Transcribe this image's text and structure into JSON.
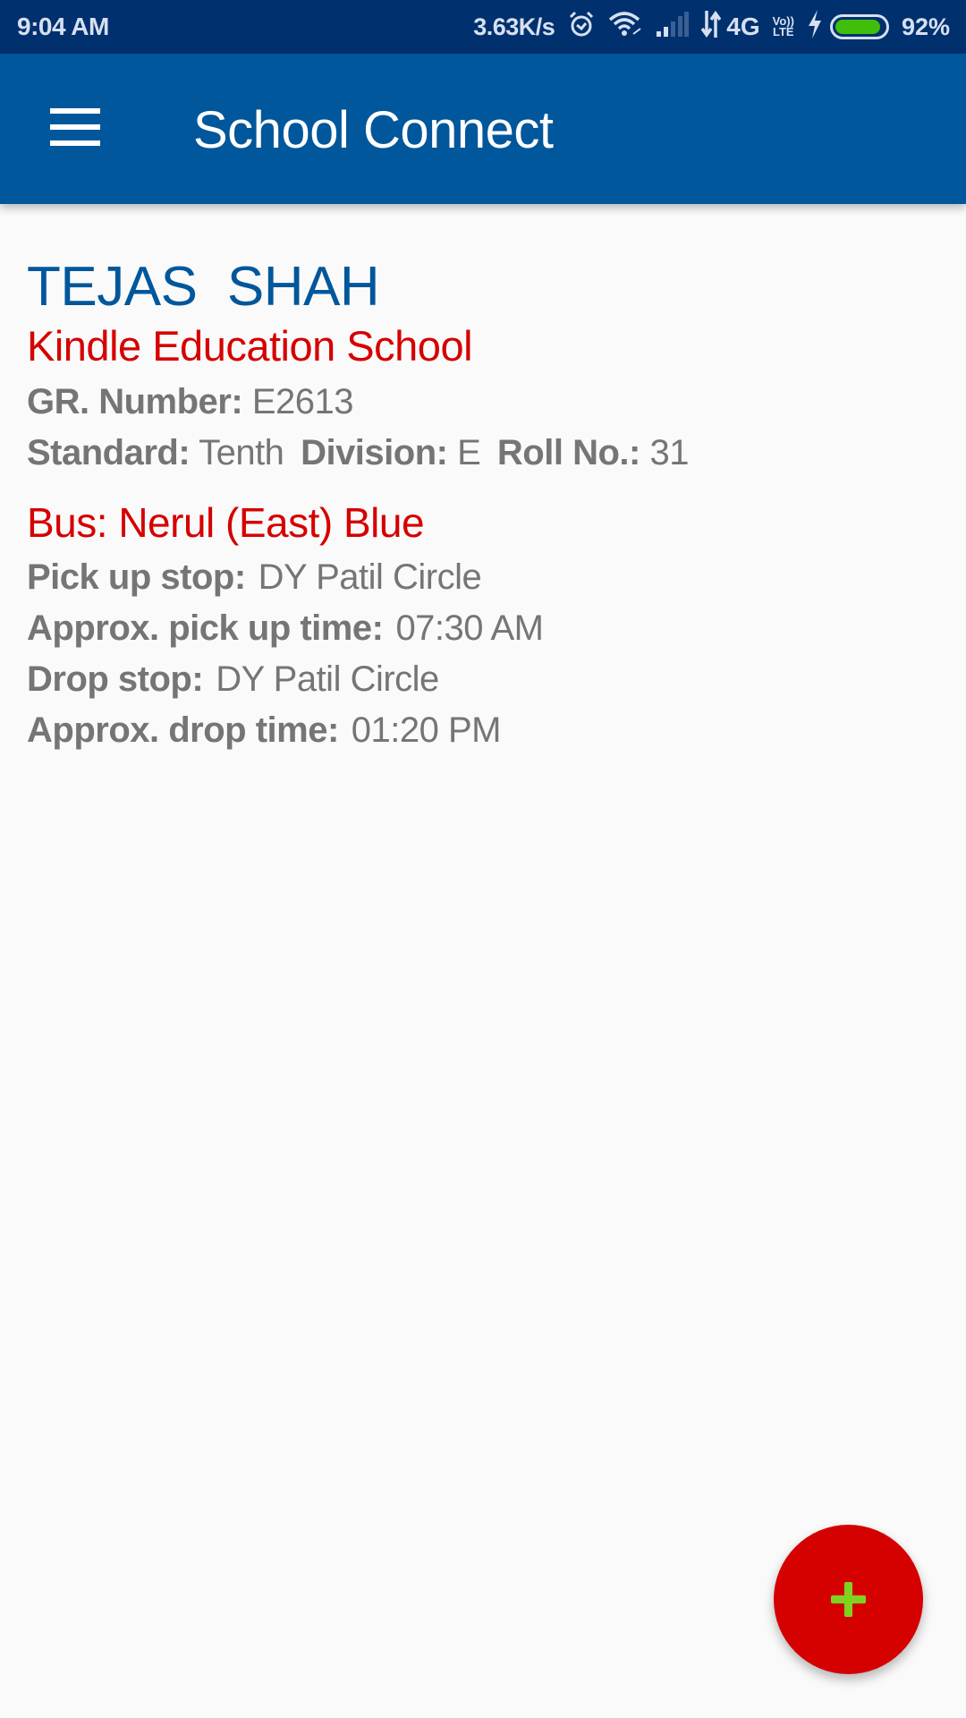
{
  "status_bar": {
    "time": "9:04 AM",
    "network_speed": "3.63K/s",
    "network_type": "4G",
    "volte_label_top": "Vo))",
    "volte_label_bottom": "LTE",
    "battery_percent_text": "92%",
    "battery_level": 0.92,
    "icons": [
      "alarm-icon",
      "wifi-icon",
      "signal-icon",
      "data-arrows-icon",
      "volte-icon",
      "charging-icon",
      "battery-icon"
    ]
  },
  "app_bar": {
    "title": "School Connect",
    "menu_icon": "hamburger-menu-icon"
  },
  "student": {
    "name": "TEJAS  SHAH",
    "school": "Kindle Education School",
    "gr_number_label": "GR. Number:",
    "gr_number": "E2613",
    "standard_label": "Standard:",
    "standard": "Tenth",
    "division_label": "Division:",
    "division": "E",
    "roll_label": "Roll No.:",
    "roll_no": "31"
  },
  "bus": {
    "title": "Bus: Nerul (East) Blue",
    "pickup_stop_label": "Pick up stop:",
    "pickup_stop": "DY Patil Circle",
    "pickup_time_label": "Approx. pick up time:",
    "pickup_time": "07:30 AM",
    "drop_stop_label": "Drop stop:",
    "drop_stop": "DY Patil Circle",
    "drop_time_label": "Approx. drop time:",
    "drop_time": "01:20 PM"
  },
  "fab": {
    "icon": "plus-icon"
  },
  "colors": {
    "status_bar": "#00306e",
    "app_bar": "#01579b",
    "accent_blue": "#01579b",
    "accent_red": "#d50000",
    "text_gray": "#757575",
    "fab_plus": "#7ed321",
    "battery_fill": "#3fbf0b"
  }
}
